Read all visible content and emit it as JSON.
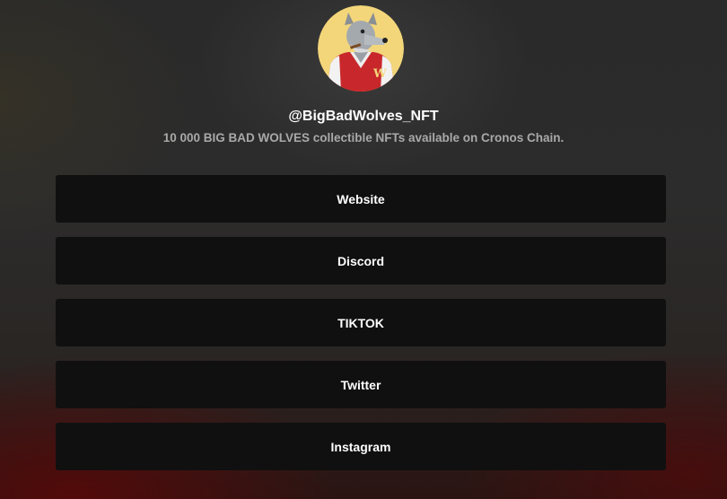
{
  "profile": {
    "handle": "@BigBadWolves_NFT",
    "bio": "10 000 BIG BAD WOLVES collectible NFTs available on Cronos Chain.",
    "avatar_icon": "wolf-in-varsity-jacket-avatar"
  },
  "links": [
    {
      "label": "Website"
    },
    {
      "label": "Discord"
    },
    {
      "label": "TIKTOK"
    },
    {
      "label": "Twitter"
    },
    {
      "label": "Instagram"
    }
  ],
  "colors": {
    "avatar_bg": "#f3d67a",
    "link_bg": "#101010",
    "bio_text": "#a9a9a9",
    "jacket_red": "#c8282b"
  }
}
